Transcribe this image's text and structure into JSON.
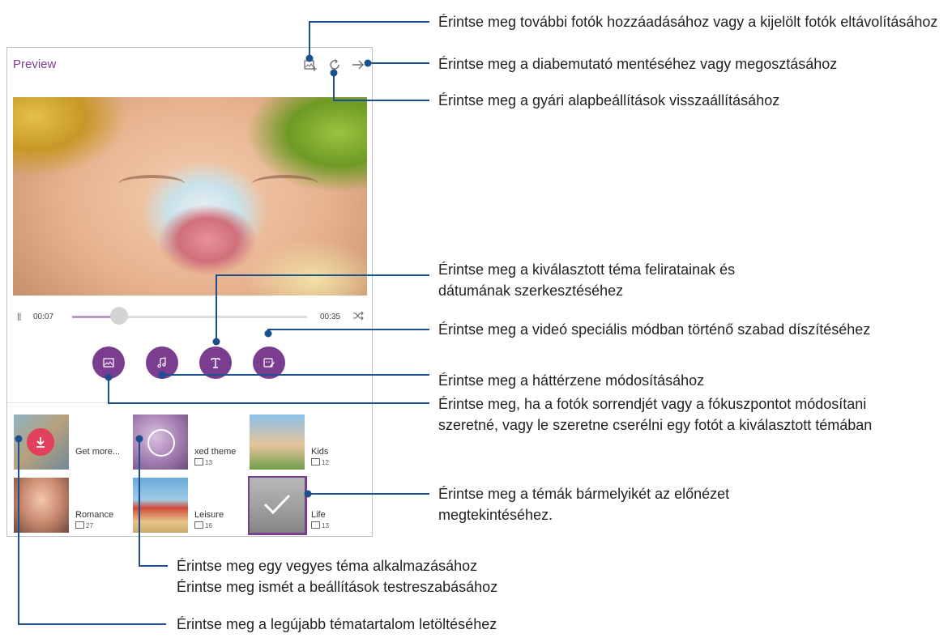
{
  "app": {
    "title": "Preview",
    "icons": {
      "add_photo": "add-photo-icon",
      "reset": "reset-icon",
      "next": "arrow-right-icon"
    }
  },
  "player": {
    "pause_glyph": "||",
    "current_time": "00:07",
    "total_time": "00:35",
    "progress_fraction": 0.2,
    "shuffle_icon": "shuffle-icon"
  },
  "tools": [
    {
      "name": "photo-edit",
      "icon": "image-icon"
    },
    {
      "name": "music",
      "icon": "music-note-icon"
    },
    {
      "name": "text",
      "icon": "text-icon"
    },
    {
      "name": "decorate",
      "icon": "sticker-edit-icon"
    }
  ],
  "themes": [
    {
      "name": "Get more...",
      "count": "",
      "download_icon": "download-icon"
    },
    {
      "name": "xed theme",
      "count": "13"
    },
    {
      "name": "Kids",
      "count": "12"
    },
    {
      "name": "Romance",
      "count": "27"
    },
    {
      "name": "Leisure",
      "count": "16"
    },
    {
      "name": "Life",
      "count": "13",
      "selected": true
    }
  ],
  "callouts": {
    "add_photos": "Érintse meg további fotók hozzáadásához vagy a kijelölt fotók eltávolításához",
    "save_share": "Érintse meg a diabemutató mentéséhez vagy megosztásához",
    "reset": "Érintse meg a gyári alapbeállítások visszaállításához",
    "edit_captions": "Érintse meg a kiválasztott téma feliratainak és dátumának szerkesztéséhez",
    "decorate": "Érintse meg a videó speciális módban történő szabad díszítéséhez",
    "music": "Érintse meg a háttérzene módosításához",
    "photo_order": "Érintse meg, ha a fotók sorrendjét vagy a fókuszpontot módosítani szeretné, vagy le szeretne cserélni egy fotót a kiválasztott témában",
    "preview_theme": "Érintse meg a témák bármelyikét az előnézet megtekintéséhez.",
    "mixed_theme_1": "Érintse meg egy vegyes téma alkalmazásához",
    "mixed_theme_2": "Érintse meg ismét a beállítások testreszabásához",
    "download": "Érintse meg a legújabb tématartalom letöltéséhez"
  },
  "colors": {
    "accent": "#7b3d90",
    "leader": "#1c4f8c",
    "download": "#e2415b"
  }
}
